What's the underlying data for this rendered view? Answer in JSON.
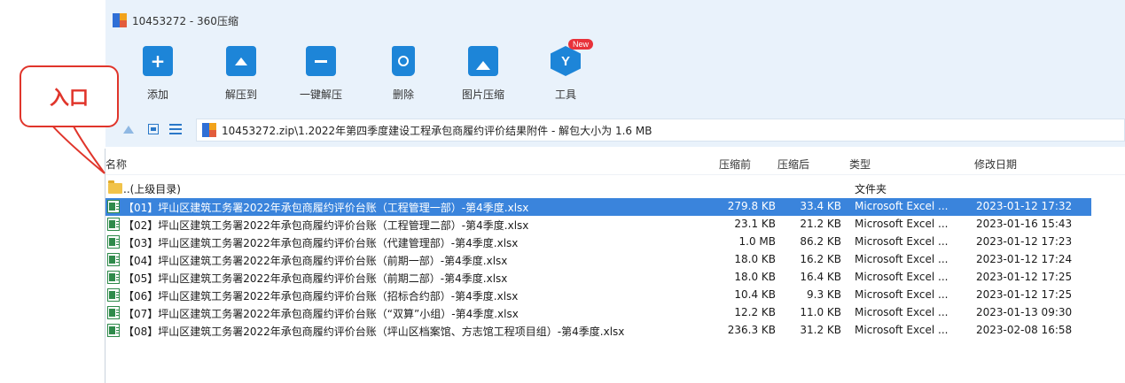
{
  "window": {
    "title": "10453272 - 360压缩"
  },
  "toolbar": {
    "add": "添加",
    "extract_to": "解压到",
    "one_click_extract": "一键解压",
    "delete": "删除",
    "image_compress": "图片压缩",
    "tools": "工具",
    "new_badge": "New"
  },
  "address": {
    "path": "10453272.zip\\1.2022年第四季度建设工程承包商履约评价结果附件 - 解包大小为 1.6 MB"
  },
  "columns": {
    "name": "名称",
    "compressed_before": "压缩前",
    "compressed_after": "压缩后",
    "type": "类型",
    "modified": "修改日期"
  },
  "parent_row": {
    "name": "..(上级目录)",
    "type": "文件夹"
  },
  "files": [
    {
      "name": "【01】坪山区建筑工务署2022年承包商履约评价台账（工程管理一部）-第4季度.xlsx",
      "before": "279.8 KB",
      "after": "33.4 KB",
      "type": "Microsoft Excel ...",
      "modified": "2023-01-12 17:32",
      "selected": true
    },
    {
      "name": "【02】坪山区建筑工务署2022年承包商履约评价台账（工程管理二部）-第4季度.xlsx",
      "before": "23.1 KB",
      "after": "21.2 KB",
      "type": "Microsoft Excel ...",
      "modified": "2023-01-16 15:43"
    },
    {
      "name": "【03】坪山区建筑工务署2022年承包商履约评价台账（代建管理部）-第4季度.xlsx",
      "before": "1.0 MB",
      "after": "86.2 KB",
      "type": "Microsoft Excel ...",
      "modified": "2023-01-12 17:23"
    },
    {
      "name": "【04】坪山区建筑工务署2022年承包商履约评价台账（前期一部）-第4季度.xlsx",
      "before": "18.0 KB",
      "after": "16.2 KB",
      "type": "Microsoft Excel ...",
      "modified": "2023-01-12 17:24"
    },
    {
      "name": "【05】坪山区建筑工务署2022年承包商履约评价台账（前期二部）-第4季度.xlsx",
      "before": "18.0 KB",
      "after": "16.4 KB",
      "type": "Microsoft Excel ...",
      "modified": "2023-01-12 17:25"
    },
    {
      "name": "【06】坪山区建筑工务署2022年承包商履约评价台账（招标合约部）-第4季度.xlsx",
      "before": "10.4 KB",
      "after": "9.3 KB",
      "type": "Microsoft Excel ...",
      "modified": "2023-01-12 17:25"
    },
    {
      "name": "【07】坪山区建筑工务署2022年承包商履约评价台账（“双算”小组）-第4季度.xlsx",
      "before": "12.2 KB",
      "after": "11.0 KB",
      "type": "Microsoft Excel ...",
      "modified": "2023-01-13 09:30"
    },
    {
      "name": "【08】坪山区建筑工务署2022年承包商履约评价台账（坪山区档案馆、方志馆工程项目组）-第4季度.xlsx",
      "before": "236.3 KB",
      "after": "31.2 KB",
      "type": "Microsoft Excel ...",
      "modified": "2023-02-08 16:58"
    }
  ],
  "callout": {
    "text": "入口",
    "color": "#e0352b"
  },
  "colors": {
    "selection": "#3a84dc",
    "accent": "#1d85d8",
    "toolbar_bg": "#e9f2fb"
  }
}
